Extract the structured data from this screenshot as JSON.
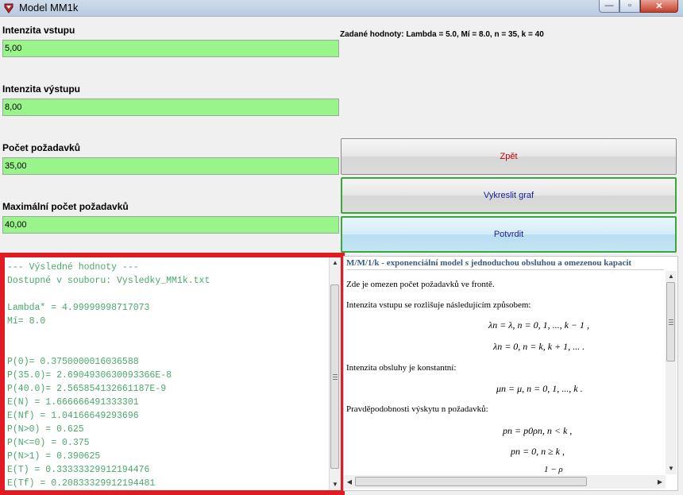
{
  "window": {
    "title": "Model MM1k",
    "min_symbol": "—",
    "max_symbol": "▫",
    "close_symbol": "✕"
  },
  "form": {
    "input_rate": {
      "label": "Intenzita vstupu",
      "value": "5,00"
    },
    "output_rate": {
      "label": "Intenzita výstupu",
      "value": "8,00"
    },
    "num_requests": {
      "label": "Počet požadavků",
      "value": "35,00"
    },
    "max_requests": {
      "label": "Maximální počet požadavků",
      "value": "40,00"
    }
  },
  "given_values": "Zadané hodnoty: Lambda = 5.0, Mí = 8.0, n = 35, k = 40",
  "buttons": {
    "back": "Zpět",
    "draw_graph": "Vykreslit graf",
    "confirm": "Potvrdit"
  },
  "results": {
    "lines": [
      "--- Výsledné hodnoty ---",
      "Dostupné v souboru: Vysledky_MM1k.txt",
      "",
      "Lambda* = 4.99999998717073",
      "Mí= 8.0",
      "",
      "",
      "P(0)= 0.3750000016036588",
      "P(35.0)= 2.6904930630093366E-8",
      "P(40.0)= 2.565854132661187E-9",
      "E(N) = 1.666666491333301",
      "E(Nf) = 1.04166649293696",
      "P(N>0) = 0.625",
      "P(N<=0) = 0.375",
      "P(N>1) = 0.390625",
      "E(T) = 0.33333329912194476",
      "E(Tf) = 0.20833329912194481"
    ]
  },
  "help": {
    "title": "M/M/1/k - exponenciální model s jednoduchou obsluhou a omezenou kapacit",
    "p1": "Zde je omezen počet požadavků ve frontě.",
    "p2": "Intenzita vstupu se rozlišuje následujícím způsobem:",
    "eq1": "λn = λ,      n = 0, 1, ..., k − 1 ,",
    "eq2": "λn = 0,      n = k, k + 1, ... .",
    "p3": "Intenzita obsluhy je konstantní:",
    "eq3": "μn = μ,      n = 0, 1, ..., k .",
    "p4": "Pravděpodobnosti výskytu n požadavků:",
    "eq4": "pn = p0ρn,      n < k ,",
    "eq5": "pn = 0,      n ≥ k ,",
    "eq6": "1 − ρ"
  }
}
